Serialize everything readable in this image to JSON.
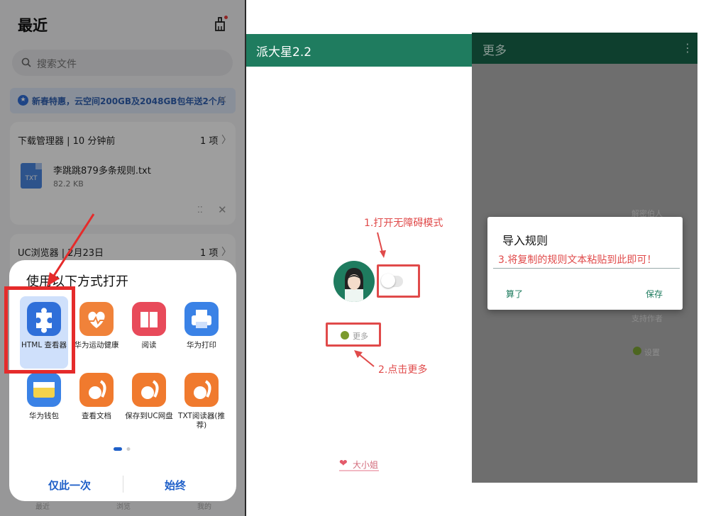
{
  "panel1": {
    "title": "最近",
    "search_placeholder": "搜索文件",
    "promo": "新春特惠，云空间200GB及2048GB包年送2个月",
    "card1": {
      "title": "下载管理器 | 10 分钟前",
      "count": "1 项",
      "file_name": "李跳跳879多条规则.txt",
      "file_size": "82.2 KB",
      "file_type": "TXT"
    },
    "card2": {
      "title": "UC浏览器 | 2月23日",
      "count": "1 项"
    },
    "sheet": {
      "title": "使用以下方式打开",
      "apps": [
        {
          "label": "HTML 查看器"
        },
        {
          "label": "华为运动健康"
        },
        {
          "label": "阅读"
        },
        {
          "label": "华为打印"
        },
        {
          "label": "华为钱包"
        },
        {
          "label": "查看文档"
        },
        {
          "label": "保存到UC网盘"
        },
        {
          "label": "TXT阅读器(推荐)"
        }
      ],
      "once": "仅此一次",
      "always": "始终"
    },
    "bottom_nav": [
      "最近",
      "浏览",
      "我的"
    ]
  },
  "panel2": {
    "title": "派大星2.2",
    "note1": "1.打开无障碍模式",
    "more": "更多",
    "note2": "2.点击更多",
    "footer": "大小姐"
  },
  "panel3": {
    "title": "更多",
    "bg_items": [
      "解密伯人",
      "支持作者",
      "设置"
    ],
    "dialog": {
      "title": "导入规则",
      "hint": "3.将复制的规则文本粘贴到此即可！",
      "cancel": "算了",
      "save": "保存"
    }
  },
  "colors": {
    "accent_green": "#1f7c5f",
    "dark_green": "#0e3f2e",
    "annotation_red": "#e04a4a",
    "link_blue": "#1e5fc8"
  },
  "icons": [
    "cleaner-icon",
    "search-icon",
    "star-badge-icon",
    "close-icon",
    "file-txt-icon",
    "puzzle-icon",
    "heart-icon",
    "book-icon",
    "printer-icon",
    "wallet-icon",
    "squirrel-icon",
    "kebab-icon"
  ]
}
